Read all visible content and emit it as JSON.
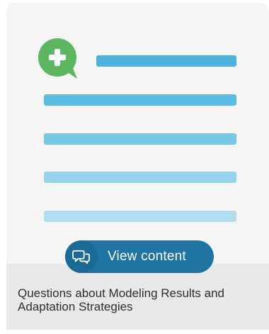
{
  "card": {
    "caption": "Questions about Modeling Results and Adaptation Strategies",
    "button_label": "View content"
  },
  "icons": {
    "badge": "add-comment-icon",
    "button": "chat-bubbles-icon"
  },
  "colors": {
    "badge_green": "#5cb660",
    "line_1": "#4db2dc",
    "line_2": "#5cbbe1",
    "line_3": "#77c7e7",
    "line_4": "#95d3ec",
    "line_5": "#b1ddf0",
    "button_bg": "#1f74a4"
  }
}
